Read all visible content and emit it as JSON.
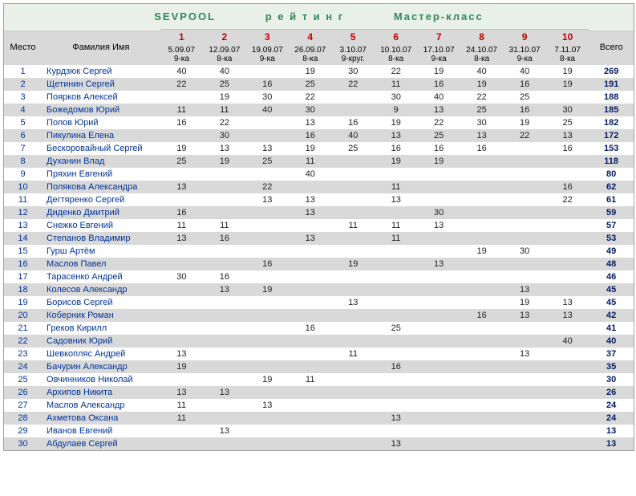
{
  "title": {
    "a": "SEVPOOL",
    "b": "р е й т и н г",
    "c": "Мастер-класс"
  },
  "head": {
    "place": "Место",
    "name": "Фамилия Имя",
    "total": "Всего"
  },
  "cols": [
    {
      "n": "1",
      "d": "5.09.07",
      "g": "9-ка"
    },
    {
      "n": "2",
      "d": "12.09.07",
      "g": "8-ка"
    },
    {
      "n": "3",
      "d": "19.09.07",
      "g": "9-ка"
    },
    {
      "n": "4",
      "d": "26.09.07",
      "g": "8-ка"
    },
    {
      "n": "5",
      "d": "3.10.07",
      "g": "9-круг."
    },
    {
      "n": "6",
      "d": "10.10.07",
      "g": "8-ка"
    },
    {
      "n": "7",
      "d": "17.10.07",
      "g": "9-ка"
    },
    {
      "n": "8",
      "d": "24.10.07",
      "g": "8-ка"
    },
    {
      "n": "9",
      "d": "31.10.07",
      "g": "9-ка"
    },
    {
      "n": "10",
      "d": "7.11.07",
      "g": "8-ка"
    }
  ],
  "rows": [
    {
      "p": "1",
      "n": "Курдзюк Сергей",
      "v": [
        "40",
        "40",
        "",
        "19",
        "30",
        "22",
        "19",
        "40",
        "40",
        "19"
      ],
      "t": "269"
    },
    {
      "p": "2",
      "n": "Щетинин Сергей",
      "v": [
        "22",
        "25",
        "16",
        "25",
        "22",
        "11",
        "16",
        "19",
        "16",
        "19"
      ],
      "t": "191"
    },
    {
      "p": "3",
      "n": "Поярков Алексей",
      "v": [
        "",
        "19",
        "30",
        "22",
        "",
        "30",
        "40",
        "22",
        "25",
        ""
      ],
      "t": "188"
    },
    {
      "p": "4",
      "n": "Божедомов Юрий",
      "v": [
        "11",
        "11",
        "40",
        "30",
        "",
        "9",
        "13",
        "25",
        "16",
        "30"
      ],
      "t": "185"
    },
    {
      "p": "5",
      "n": "Попов Юрий",
      "v": [
        "16",
        "22",
        "",
        "13",
        "16",
        "19",
        "22",
        "30",
        "19",
        "25"
      ],
      "t": "182"
    },
    {
      "p": "6",
      "n": "Пикулина Елена",
      "v": [
        "",
        "30",
        "",
        "16",
        "40",
        "13",
        "25",
        "13",
        "22",
        "13"
      ],
      "t": "172"
    },
    {
      "p": "7",
      "n": "Бескоровайный Сергей",
      "v": [
        "19",
        "13",
        "13",
        "19",
        "25",
        "16",
        "16",
        "16",
        "",
        "16"
      ],
      "t": "153"
    },
    {
      "p": "8",
      "n": "Духанин Влад",
      "v": [
        "25",
        "19",
        "25",
        "11",
        "",
        "19",
        "19",
        "",
        "",
        ""
      ],
      "t": "118"
    },
    {
      "p": "9",
      "n": "Пряхин Евгений",
      "v": [
        "",
        "",
        "",
        "40",
        "",
        "",
        "",
        "",
        "",
        ""
      ],
      "t": "80"
    },
    {
      "p": "10",
      "n": "Полякова Александра",
      "v": [
        "13",
        "",
        "22",
        "",
        "",
        "11",
        "",
        "",
        "",
        "16"
      ],
      "t": "62"
    },
    {
      "p": "11",
      "n": "Дегтяренко Сергей",
      "v": [
        "",
        "",
        "13",
        "13",
        "",
        "13",
        "",
        "",
        "",
        "22"
      ],
      "t": "61"
    },
    {
      "p": "12",
      "n": "Диденко Дмитрий",
      "v": [
        "16",
        "",
        "",
        "13",
        "",
        "",
        "30",
        "",
        "",
        ""
      ],
      "t": "59"
    },
    {
      "p": "13",
      "n": "Снежко Евгений",
      "v": [
        "11",
        "11",
        "",
        "",
        "11",
        "11",
        "13",
        "",
        "",
        ""
      ],
      "t": "57"
    },
    {
      "p": "14",
      "n": "Степанов Владимир",
      "v": [
        "13",
        "16",
        "",
        "13",
        "",
        "11",
        "",
        "",
        "",
        ""
      ],
      "t": "53"
    },
    {
      "p": "15",
      "n": "Гурш Артём",
      "v": [
        "",
        "",
        "",
        "",
        "",
        "",
        "",
        "19",
        "30",
        ""
      ],
      "t": "49"
    },
    {
      "p": "16",
      "n": "Маслов Павел",
      "v": [
        "",
        "",
        "16",
        "",
        "19",
        "",
        "13",
        "",
        "",
        ""
      ],
      "t": "48"
    },
    {
      "p": "17",
      "n": "Тарасенко Андрей",
      "v": [
        "30",
        "16",
        "",
        "",
        "",
        "",
        "",
        "",
        "",
        ""
      ],
      "t": "46"
    },
    {
      "p": "18",
      "n": "Колесов Александр",
      "v": [
        "",
        "13",
        "19",
        "",
        "",
        "",
        "",
        "",
        "13",
        ""
      ],
      "t": "45"
    },
    {
      "p": "19",
      "n": "Борисов Сергей",
      "v": [
        "",
        "",
        "",
        "",
        "13",
        "",
        "",
        "",
        "19",
        "13"
      ],
      "t": "45"
    },
    {
      "p": "20",
      "n": "Коберник Роман",
      "v": [
        "",
        "",
        "",
        "",
        "",
        "",
        "",
        "16",
        "13",
        "13"
      ],
      "t": "42"
    },
    {
      "p": "21",
      "n": "Греков Кирилл",
      "v": [
        "",
        "",
        "",
        "16",
        "",
        "25",
        "",
        "",
        "",
        ""
      ],
      "t": "41"
    },
    {
      "p": "22",
      "n": "Садовник Юрий",
      "v": [
        "",
        "",
        "",
        "",
        "",
        "",
        "",
        "",
        "",
        "40"
      ],
      "t": "40"
    },
    {
      "p": "23",
      "n": "Шевкопляс Андрей",
      "v": [
        "13",
        "",
        "",
        "",
        "11",
        "",
        "",
        "",
        "13",
        ""
      ],
      "t": "37"
    },
    {
      "p": "24",
      "n": "Бачурин Александр",
      "v": [
        "19",
        "",
        "",
        "",
        "",
        "16",
        "",
        "",
        "",
        ""
      ],
      "t": "35"
    },
    {
      "p": "25",
      "n": "Овчинников Николай",
      "v": [
        "",
        "",
        "19",
        "11",
        "",
        "",
        "",
        "",
        "",
        ""
      ],
      "t": "30"
    },
    {
      "p": "26",
      "n": "Архипов Никита",
      "v": [
        "13",
        "13",
        "",
        "",
        "",
        "",
        "",
        "",
        "",
        ""
      ],
      "t": "26"
    },
    {
      "p": "27",
      "n": "Маслов Александр",
      "v": [
        "11",
        "",
        "13",
        "",
        "",
        "",
        "",
        "",
        "",
        ""
      ],
      "t": "24"
    },
    {
      "p": "28",
      "n": "Ахметова Оксана",
      "v": [
        "11",
        "",
        "",
        "",
        "",
        "13",
        "",
        "",
        "",
        ""
      ],
      "t": "24"
    },
    {
      "p": "29",
      "n": "Иванов Евгений",
      "v": [
        "",
        "13",
        "",
        "",
        "",
        "",
        "",
        "",
        "",
        ""
      ],
      "t": "13"
    },
    {
      "p": "30",
      "n": "Абдулаев Сергей",
      "v": [
        "",
        "",
        "",
        "",
        "",
        "13",
        "",
        "",
        "",
        ""
      ],
      "t": "13"
    }
  ]
}
